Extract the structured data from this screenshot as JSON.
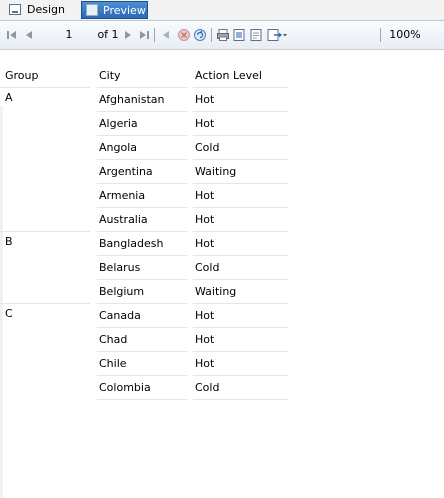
{
  "tabs": {
    "design": "Design",
    "preview": "Preview"
  },
  "toolbar": {
    "page_number": "1",
    "of_pages": "of 1",
    "zoom": "100%"
  },
  "report": {
    "headers": {
      "group": "Group",
      "city": "City",
      "action": "Action Level"
    },
    "rows": [
      {
        "group": "A",
        "city": "Afghanistan",
        "action": "Hot"
      },
      {
        "group": "",
        "city": "Algeria",
        "action": "Hot"
      },
      {
        "group": "",
        "city": "Angola",
        "action": "Cold"
      },
      {
        "group": "",
        "city": "Argentina",
        "action": "Waiting"
      },
      {
        "group": "",
        "city": "Armenia",
        "action": "Hot"
      },
      {
        "group": "",
        "city": "Australia",
        "action": "Hot"
      },
      {
        "group": "B",
        "city": "Bangladesh",
        "action": "Hot"
      },
      {
        "group": "",
        "city": "Belarus",
        "action": "Cold"
      },
      {
        "group": "",
        "city": "Belgium",
        "action": "Waiting"
      },
      {
        "group": "C",
        "city": "Canada",
        "action": "Hot"
      },
      {
        "group": "",
        "city": "Chad",
        "action": "Hot"
      },
      {
        "group": "",
        "city": "Chile",
        "action": "Hot"
      },
      {
        "group": "",
        "city": "Colombia",
        "action": "Cold"
      }
    ]
  },
  "icons": {
    "first_page": "first-page-icon",
    "prev_page": "previous-page-icon",
    "next_page": "next-page-icon",
    "last_page": "last-page-icon",
    "back": "back-icon",
    "stop": "stop-icon",
    "refresh": "refresh-icon",
    "print": "print-icon",
    "print_layout": "print-layout-icon",
    "page_setup": "page-setup-icon",
    "export": "export-icon"
  },
  "colors": {
    "accent": "#2c6ab4",
    "toolbar_bg": "#e9eef5"
  }
}
